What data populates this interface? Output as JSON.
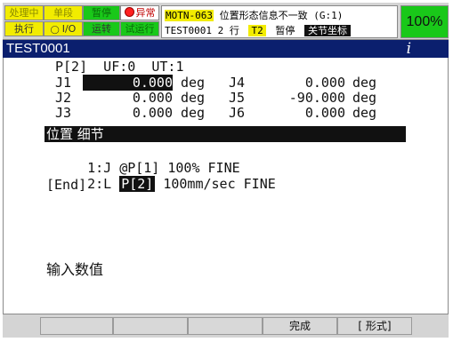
{
  "status": {
    "lamps_row1": [
      {
        "label": "处理中",
        "style": "yellow"
      },
      {
        "label": "单段",
        "style": "yellow"
      },
      {
        "label": "暂停",
        "style": "green"
      },
      {
        "label": "异常",
        "style": "white",
        "icon": "alarm-dot-icon"
      }
    ],
    "lamps_row2": [
      {
        "label": "执行",
        "style": "yellow"
      },
      {
        "label": "I/O",
        "style": "yellow",
        "icon": "io-icon"
      },
      {
        "label": "运转",
        "style": "green"
      },
      {
        "label": "试运行",
        "style": "green"
      }
    ],
    "message": {
      "code": "MOTN-063",
      "text": "位置形态信息不一致 (G:1)",
      "program": "TEST0001",
      "line_no": "2",
      "line_unit": "行",
      "group": "T2",
      "state": "暂停",
      "coord_frame": "关节坐标"
    },
    "override": "100%",
    "accent_yellow": "#f2ec00",
    "accent_green": "#19c819"
  },
  "title": {
    "program": "TEST0001",
    "info_icon": "i",
    "bar_color": "#0b1f6e"
  },
  "position": {
    "header": "P[2]  UF:0  UT:1",
    "joints_left": [
      {
        "name": "J1",
        "value": "0.000",
        "unit": "deg"
      },
      {
        "name": "J2",
        "value": "0.000",
        "unit": "deg"
      },
      {
        "name": "J3",
        "value": "0.000",
        "unit": "deg"
      }
    ],
    "joints_right": [
      {
        "name": "J4",
        "value": "0.000",
        "unit": "deg"
      },
      {
        "name": "J5",
        "value": "-90.000",
        "unit": "deg"
      },
      {
        "name": "J6",
        "value": "0.000",
        "unit": "deg"
      }
    ]
  },
  "section": {
    "title": "位置 细节"
  },
  "program_lines": [
    {
      "num": "1:",
      "motion": "J",
      "pos": "@P[1]",
      "speed": "100%",
      "term": "FINE"
    },
    {
      "num": "2:",
      "motion": "L",
      "pos": "P[2]",
      "speed": "100mm/sec",
      "term": "FINE"
    }
  ],
  "end_marker": "[End]",
  "prompt": "输入数值",
  "fkeys": [
    {
      "label": ""
    },
    {
      "label": ""
    },
    {
      "label": ""
    },
    {
      "label": "完成"
    },
    {
      "label": "[ 形式]"
    }
  ]
}
